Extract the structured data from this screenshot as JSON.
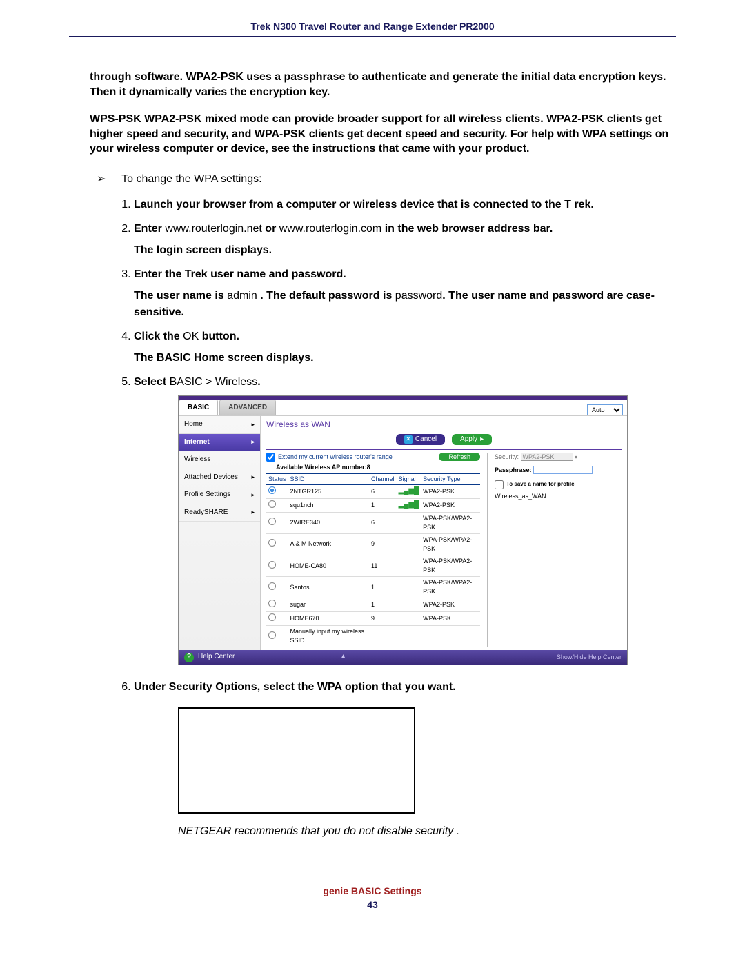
{
  "header": {
    "title": "Trek N300 Travel Router and Range Extender PR2000"
  },
  "paragraphs": {
    "p1": "through software. WPA2-PSK uses a passphrase to authenticate and generate the initial data encryption keys. Then it dynamically varies the encryption key.",
    "p2": "WPS-PSK  WPA2-PSK mixed mode can provide broader support for all wireless clients. WPA2-PSK clients get higher speed and security, and WPA-PSK clients get decent speed and security. For help with WPA settings on your wireless computer or device, see the instructions that came with your product."
  },
  "lead": "To change the WPA settings:",
  "steps": {
    "s1": "Launch your browser from a computer or wireless device that is connected to the T   rek.",
    "s2a": "Enter ",
    "s2_url1": "www.routerlogin.net",
    "s2_or": "   or ",
    "s2_url2": "www.routerlogin.com",
    "s2b": " in the web browser address bar.",
    "s2c": "The login screen displays.",
    "s3a": "Enter the Trek user name and password.",
    "s3b_pre": "The user name is ",
    "s3b_admin": "admin",
    "s3b_mid": " . The default password is ",
    "s3b_pwd": "password",
    "s3b_post": ". The user name and password are case-sensitive.",
    "s4a_pre": "Click the ",
    "s4a_ok": "OK",
    "s4a_post": " button.",
    "s4b": "The BASIC Home screen displays.",
    "s5_pre": "Select ",
    "s5_path": "BASIC > Wireless",
    "s5_post": ".",
    "s6": "Under Security Options, select the WPA option that you want."
  },
  "note": "NETGEAR recommends that you do not disable security       .",
  "ui": {
    "tabs": {
      "basic": "BASIC",
      "advanced": "ADVANCED"
    },
    "auto": "Auto",
    "sidebar": [
      {
        "label": "Home",
        "arrow": true,
        "selected": false
      },
      {
        "label": "Internet",
        "arrow": true,
        "selected": true
      },
      {
        "label": "Wireless",
        "arrow": false,
        "selected": false
      },
      {
        "label": "Attached Devices",
        "arrow": true,
        "selected": false
      },
      {
        "label": "Profile Settings",
        "arrow": true,
        "selected": false
      },
      {
        "label": "ReadySHARE",
        "arrow": true,
        "selected": false
      }
    ],
    "pane_title": "Wireless as WAN",
    "cancel": "Cancel",
    "apply": "Apply",
    "refresh": "Refresh",
    "extend_label": "Extend my current wireless router's range",
    "available": "Available Wireless AP number:8",
    "cols": {
      "status": "Status",
      "ssid": "SSID",
      "channel": "Channel",
      "signal": "Signal",
      "sectype": "Security Type"
    },
    "rows": [
      {
        "sel": true,
        "ssid": "2NTGR125",
        "ch": "6",
        "sig": "high",
        "sec": "WPA2-PSK"
      },
      {
        "sel": false,
        "ssid": "squ1nch",
        "ch": "1",
        "sig": "high",
        "sec": "WPA2-PSK"
      },
      {
        "sel": false,
        "ssid": "2WIRE340",
        "ch": "6",
        "sig": "",
        "sec": "WPA-PSK/WPA2-PSK"
      },
      {
        "sel": false,
        "ssid": "A & M Network",
        "ch": "9",
        "sig": "",
        "sec": "WPA-PSK/WPA2-PSK"
      },
      {
        "sel": false,
        "ssid": "HOME-CA80",
        "ch": "11",
        "sig": "",
        "sec": "WPA-PSK/WPA2-PSK"
      },
      {
        "sel": false,
        "ssid": "Santos",
        "ch": "1",
        "sig": "",
        "sec": "WPA-PSK/WPA2-PSK"
      },
      {
        "sel": false,
        "ssid": "sugar",
        "ch": "1",
        "sig": "",
        "sec": "WPA2-PSK"
      },
      {
        "sel": false,
        "ssid": "HOME670",
        "ch": "9",
        "sig": "",
        "sec": "WPA-PSK"
      },
      {
        "sel": false,
        "ssid": "Manually input my wireless SSID",
        "ch": "",
        "sig": "",
        "sec": ""
      }
    ],
    "security_label": "Security:",
    "security_value": "WPA2-PSK",
    "passphrase_label": "Passphrase:",
    "save_label": "To save a name for profile",
    "profile_name": "Wireless_as_WAN",
    "help_center": "Help Center",
    "show_hide": "Show/Hide Help Center"
  },
  "footer": {
    "section": "genie BASIC Settings",
    "page": "43"
  }
}
